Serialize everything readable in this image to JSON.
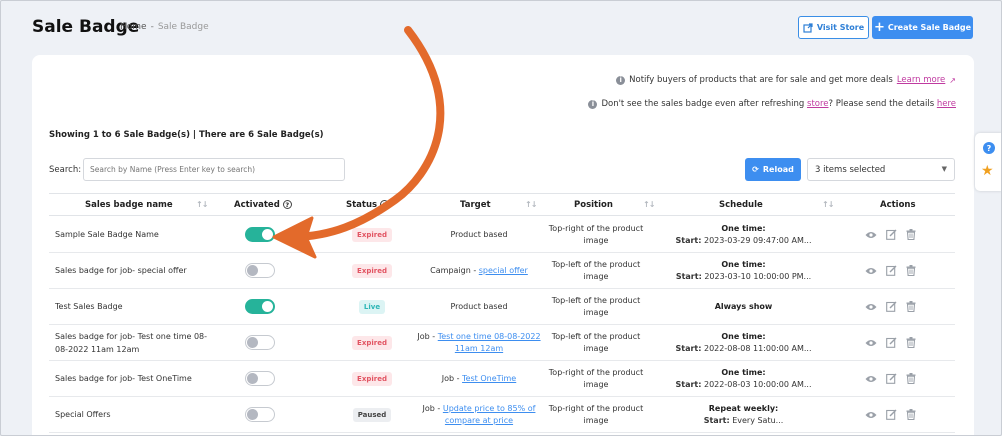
{
  "header": {
    "title": "Sale Badge",
    "breadcrumb": {
      "home": "Home",
      "sep": "-",
      "current": "Sale Badge"
    },
    "visit_store": "Visit Store",
    "create": "Create Sale Badge"
  },
  "notices": {
    "notify_text": "Notify buyers of products that are for sale and get more deals",
    "learn_more": "Learn more",
    "refresh_pre": "Don't see the sales badge even after refreshing",
    "refresh_store": "store",
    "refresh_mid": "? Please send the details",
    "refresh_here": "here"
  },
  "showing": "Showing 1 to 6 Sale Badge(s) | There are 6 Sale Badge(s)",
  "search": {
    "label": "Search:",
    "placeholder": "Search by Name (Press Enter key to search)"
  },
  "reload": "Reload",
  "items_selected": "3 items selected",
  "columns": {
    "name": "Sales badge name",
    "activated": "Activated",
    "status": "Status",
    "target": "Target",
    "position": "Position",
    "schedule": "Schedule",
    "actions": "Actions"
  },
  "rows": [
    {
      "name": "Sample Sale Badge Name",
      "activated": true,
      "status": "Expired",
      "target_pre": "Product based",
      "target_link": "",
      "position": "Top-right of the product image",
      "sched_title": "One time:",
      "sched_label": "Start:",
      "sched_value": "2023-03-29 09:47:00 AM..."
    },
    {
      "name": "Sales badge for job- special offer",
      "activated": false,
      "status": "Expired",
      "target_pre": "Campaign - ",
      "target_link": "special offer",
      "position": "Top-left of the product image",
      "sched_title": "One time:",
      "sched_label": "Start:",
      "sched_value": "2023-03-10 10:00:00 PM..."
    },
    {
      "name": "Test Sales Badge",
      "activated": true,
      "status": "Live",
      "target_pre": "Product based",
      "target_link": "",
      "position": "Top-left of the product image",
      "sched_title": "Always show",
      "sched_label": "",
      "sched_value": ""
    },
    {
      "name": "Sales badge for job- Test one time 08-08-2022 11am 12am",
      "activated": false,
      "status": "Expired",
      "target_pre": "Job - ",
      "target_link": "Test one time 08-08-2022 11am 12am",
      "position": "Top-left of the product image",
      "sched_title": "One time:",
      "sched_label": "Start:",
      "sched_value": "2022-08-08 11:00:00 AM..."
    },
    {
      "name": "Sales badge for job- Test OneTime",
      "activated": false,
      "status": "Expired",
      "target_pre": "Job - ",
      "target_link": "Test OneTime",
      "position": "Top-right of the product image",
      "sched_title": "One time:",
      "sched_label": "Start:",
      "sched_value": "2022-08-03 10:00:00 AM..."
    },
    {
      "name": "Special Offers",
      "activated": false,
      "status": "Paused",
      "target_pre": "Job - ",
      "target_link": "Update price to 85% of compare at price",
      "position": "Top-right of the product image",
      "sched_title": "Repeat weekly:",
      "sched_label": "Start:",
      "sched_value": "Every Satu..."
    }
  ]
}
